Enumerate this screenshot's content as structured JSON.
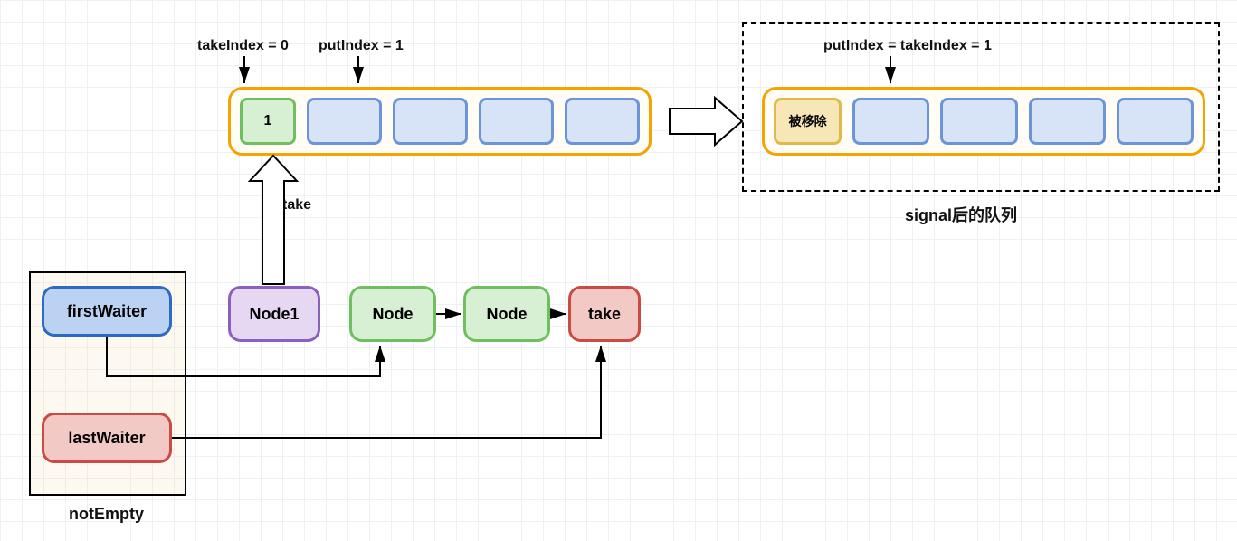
{
  "labels": {
    "takeIndex": "takeIndex = 0",
    "putIndex": "putIndex = 1",
    "combinedIndex": "putIndex = takeIndex = 1",
    "take": "take",
    "notEmpty": "notEmpty",
    "signalQueue": "signal后的队列"
  },
  "waiter": {
    "first": "firstWaiter",
    "last": "lastWaiter"
  },
  "nodes": {
    "node1": "Node1",
    "nodeA": "Node",
    "nodeB": "Node",
    "takeNode": "take"
  },
  "leftArray": {
    "cell0": "1",
    "cell1": "",
    "cell2": "",
    "cell3": "",
    "cell4": ""
  },
  "rightArray": {
    "cell0": "被移除",
    "cell1": "",
    "cell2": "",
    "cell3": "",
    "cell4": ""
  }
}
